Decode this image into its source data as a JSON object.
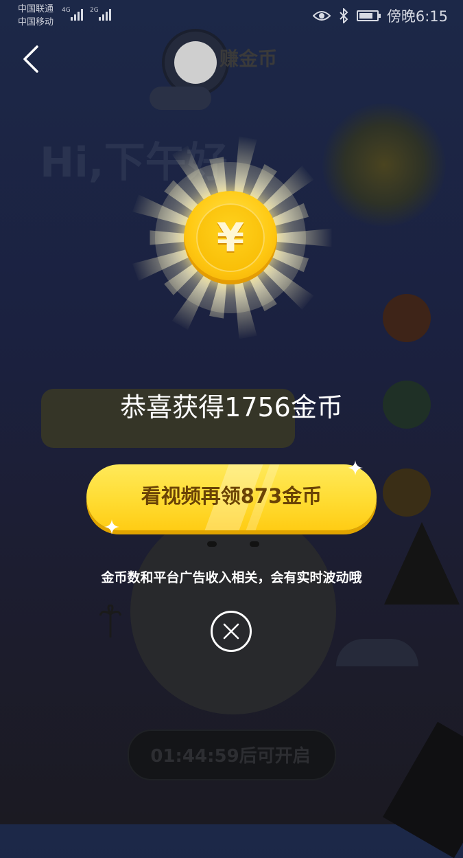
{
  "status_bar": {
    "carrier_1": "中国联通",
    "carrier_2": "中国移动",
    "network_1": "4G",
    "network_2": "2G",
    "time": "傍晚6:15",
    "icons": [
      "eye-icon",
      "bluetooth-icon",
      "battery-icon"
    ],
    "battery_level": 0.8
  },
  "background_page": {
    "title": "赚金币",
    "greeting": "Hi,下午好",
    "bottom_button": "01:44:59后可开启"
  },
  "reward_dialog": {
    "coin_symbol": "¥",
    "title": "恭喜获得1756金币",
    "watch_video_button": "看视频再领873金币",
    "disclaimer": "金币数和平台广告收入相关，会有实时波动哦",
    "close_icon": "close-icon"
  },
  "colors": {
    "button_yellow": "#ffdc32",
    "button_text": "#6a4306",
    "coin_gold": "#ffc913",
    "overlay_bg": "#1c2440"
  }
}
